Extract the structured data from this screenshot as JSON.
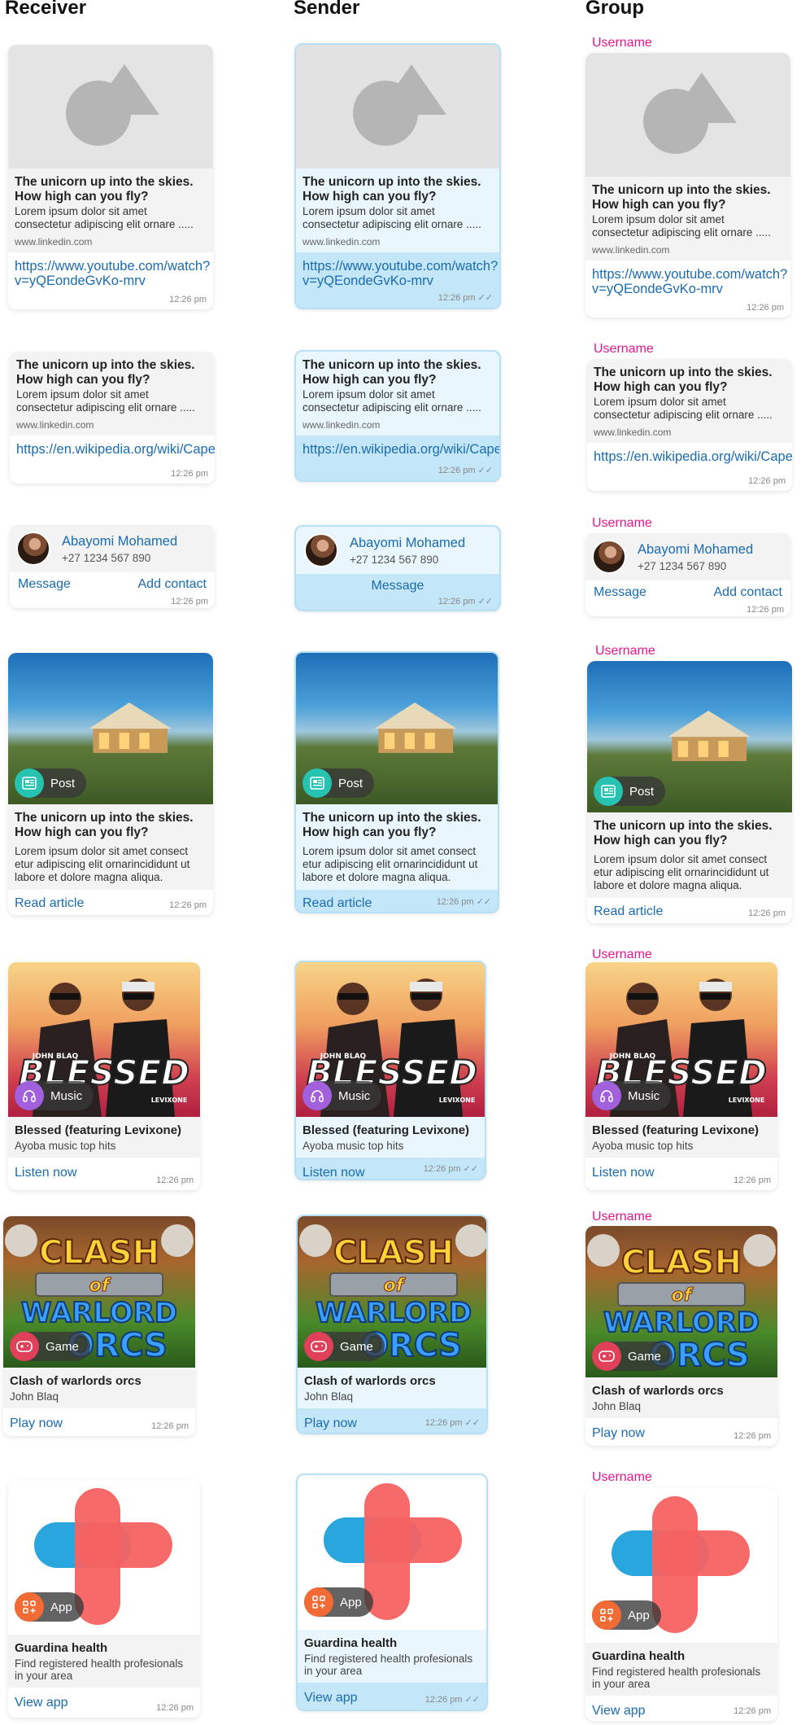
{
  "columns": {
    "receiver": "Receiver",
    "sender": "Sender",
    "group": "Group"
  },
  "group_username": "Username",
  "time": "12:26 pm",
  "read_ticks": "✓✓",
  "link_preview_1": {
    "title": "The unicorn up into the skies. How high can you fly?",
    "desc": "Lorem ipsum dolor sit amet consectetur adipiscing elit ornare .....",
    "domain": "www.linkedin.com",
    "url": "https://www.youtube.com/watch?v=yQEondeGvKo-mrv"
  },
  "link_preview_2": {
    "title": "The unicorn up into the skies. How high can you fly?",
    "desc": "Lorem ipsum dolor sit amet consectetur adipiscing elit ornare .....",
    "domain": "www.linkedin.com",
    "url": "https://en.wikipedia.org/wiki/Cape_Town"
  },
  "contact": {
    "name": "Abayomi Mohamed",
    "phone": "+27 1234 567 890",
    "message": "Message",
    "add_contact": "Add contact"
  },
  "post": {
    "badge": "Post",
    "title": "The unicorn up into the skies. How high can you fly?",
    "desc": "Lorem ipsum dolor sit amet consect etur adipiscing elit ornarincididunt ut labore et dolore magna aliqua.",
    "action": "Read article",
    "badge_color": "#25c3b0"
  },
  "music": {
    "badge": "Music",
    "title": "Blessed (featuring Levixone)",
    "subtitle": "Ayoba music top hits",
    "action": "Listen now",
    "badge_color": "#a260dc",
    "art_text": "BLESSED",
    "artist_left": "JOHN BLAQ",
    "artist_right": "LEVIXONE"
  },
  "game": {
    "badge": "Game",
    "title": "Clash of warlords orcs",
    "subtitle": "John Blaq",
    "action": "Play now",
    "badge_color": "#e0405a",
    "art_line1": "CLASH",
    "art_line2": "of",
    "art_line3": "WARLORD",
    "art_line4": "ORCS"
  },
  "app": {
    "badge": "App",
    "title": "Guardina health",
    "subtitle": "Find registered health profesionals in your area",
    "action": "View app",
    "badge_color": "#f26b35"
  },
  "colors": {
    "accent": "#1a6bb0",
    "sender_bubble": "#c3e6f8",
    "username": "#e0178f"
  }
}
